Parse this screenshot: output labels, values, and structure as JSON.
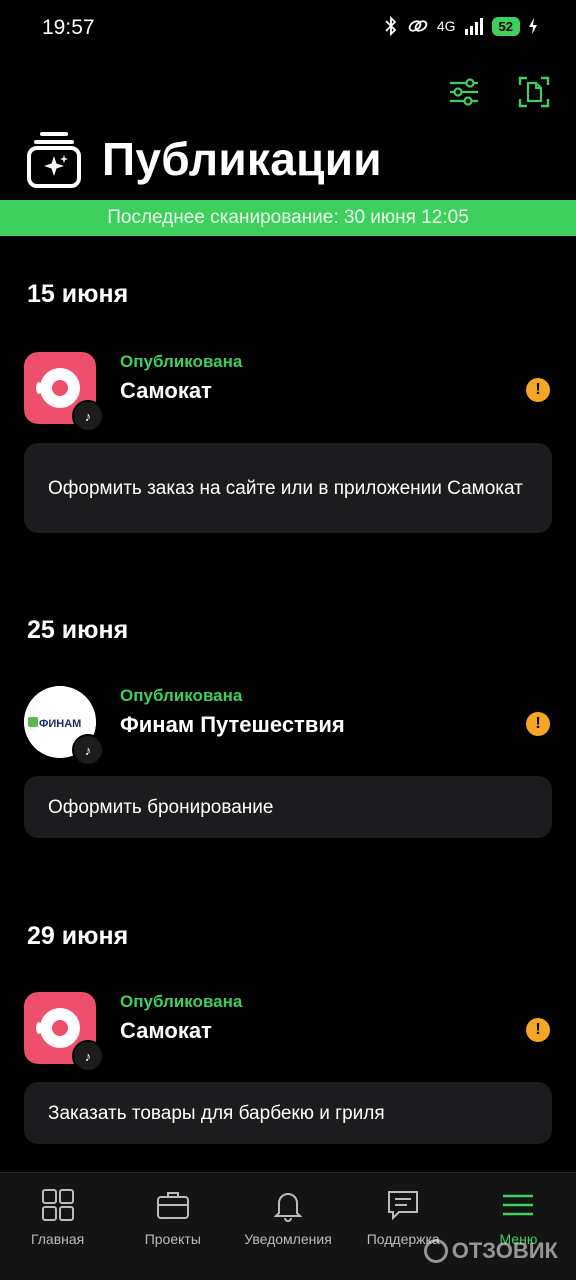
{
  "status_bar": {
    "time": "19:57",
    "network": "4G",
    "battery": "52",
    "icons": [
      "bluetooth-icon",
      "link-icon",
      "signal-icon",
      "battery-icon",
      "charging-icon"
    ]
  },
  "top_actions": {
    "filter_icon": "sliders-icon",
    "scan_icon": "document-scan-icon"
  },
  "header": {
    "title": "Публикации",
    "icon": "publications-stack-icon"
  },
  "scan_bar": {
    "text": "Последнее сканирование: 30 июня 12:05"
  },
  "groups": [
    {
      "date": "15 июня",
      "status": "Опубликована",
      "app": "Самокат",
      "logo": "samokat",
      "task": "Оформить заказ на сайте или в приложении Самокат"
    },
    {
      "date": "25 июня",
      "status": "Опубликована",
      "app": "Финам Путешествия",
      "logo": "finam",
      "logo_text": "ФИНАМ",
      "task": "Оформить бронирование"
    },
    {
      "date": "29 июня",
      "status": "Опубликована",
      "app": "Самокат",
      "logo": "samokat",
      "task": "Заказать товары для барбекю и гриля"
    }
  ],
  "bottom_nav": [
    {
      "label": "Главная",
      "icon": "grid-icon",
      "active": false
    },
    {
      "label": "Проекты",
      "icon": "briefcase-icon",
      "active": false
    },
    {
      "label": "Уведомления",
      "icon": "bell-icon",
      "active": false
    },
    {
      "label": "Поддержка",
      "icon": "chat-icon",
      "active": false
    },
    {
      "label": "Меню",
      "icon": "menu-icon",
      "active": true
    }
  ],
  "watermark": "ОТЗОВИК",
  "colors": {
    "accent": "#3ecf5c",
    "warning": "#f5a623",
    "samokat": "#ee4f6c",
    "card": "#1c1c1e",
    "background": "#000000"
  }
}
